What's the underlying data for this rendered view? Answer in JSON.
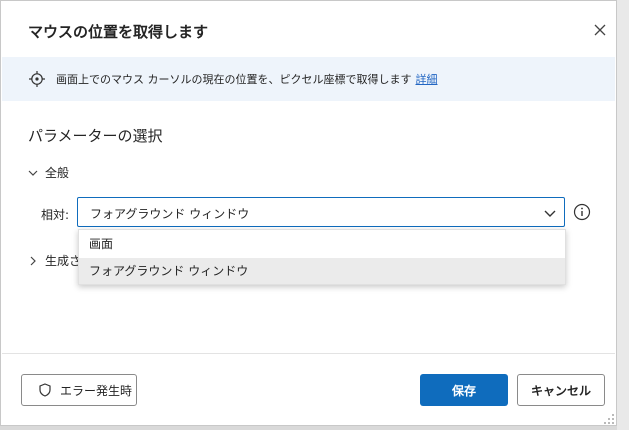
{
  "dialog": {
    "title": "マウスの位置を取得します"
  },
  "info": {
    "text": "画面上でのマウス カーソルの現在の位置を、ピクセル座標で取得します",
    "link": "詳細"
  },
  "parameters": {
    "section_title": "パラメーターの選択",
    "general_group": "全般",
    "relative_label": "相対:",
    "relative_value": "フォアグラウンド ウィンドウ",
    "dropdown_options": [
      "画面",
      "フォアグラウンド ウィンドウ"
    ],
    "generated_group_partial": "生成さ"
  },
  "footer": {
    "on_error_label": "エラー発生時",
    "save_label": "保存",
    "cancel_label": "キャンセル"
  },
  "colors": {
    "accent": "#0f6cbd",
    "info_bg": "#eef4fb",
    "link": "#2266c3"
  }
}
